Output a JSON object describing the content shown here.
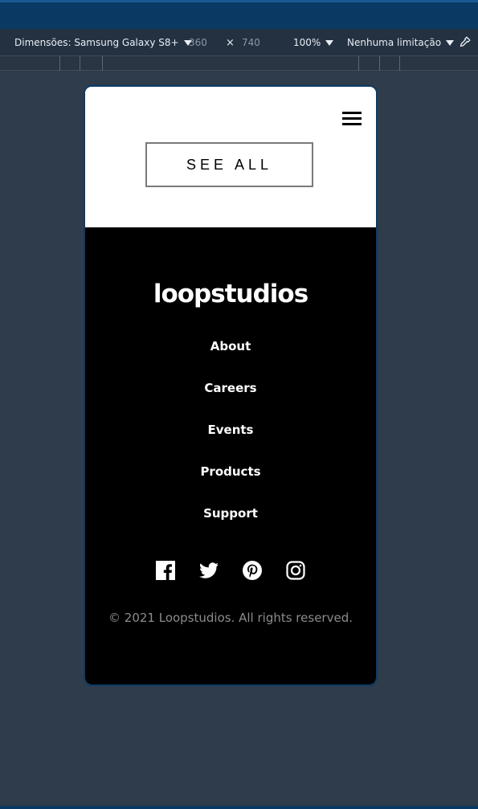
{
  "toolbar": {
    "device_label": "Dimensões: Samsung Galaxy S8+",
    "width_value": "360",
    "times": "×",
    "height_value": "740",
    "zoom_value": "100%",
    "throttle_value": "Nenhuma limitação",
    "pipette_icon": "eyedropper-icon"
  },
  "page": {
    "see_all_label": "SEE ALL",
    "menu_icon": "hamburger-menu-icon",
    "brand": "loopstudios",
    "nav": [
      "About",
      "Careers",
      "Events",
      "Products",
      "Support"
    ],
    "socials": [
      "facebook-icon",
      "twitter-icon",
      "pinterest-icon",
      "instagram-icon"
    ],
    "copyright": "© 2021 Loopstudios. All rights reserved."
  },
  "colors": {
    "devtools_bg": "#2f3c4c",
    "window_top": "#0a3a63",
    "footer_bg": "#000000",
    "copyright_text": "#8c8c8c"
  }
}
